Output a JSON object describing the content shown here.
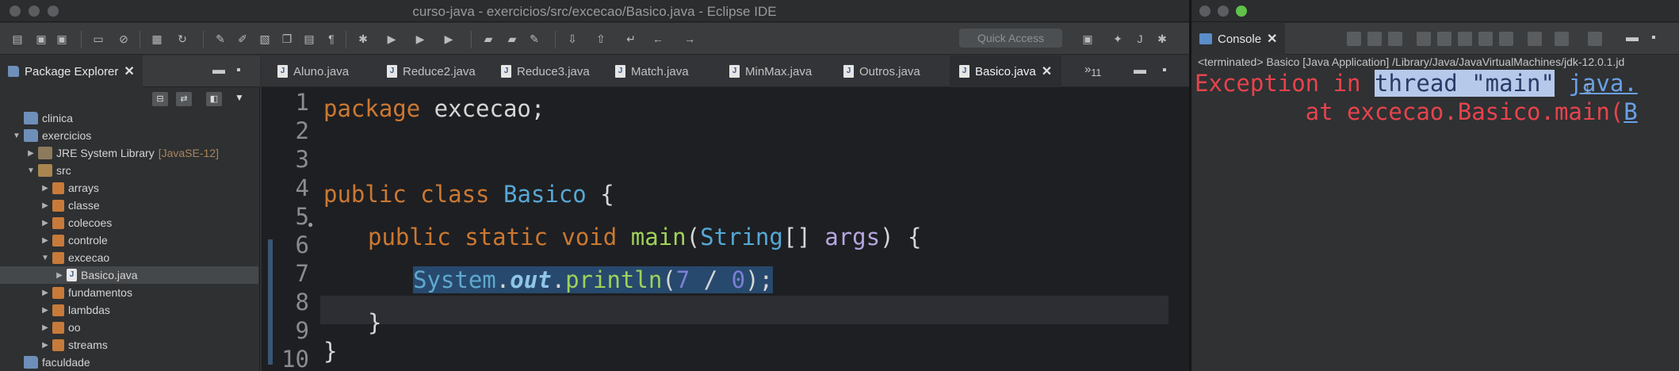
{
  "main_window": {
    "title": "curso-java - exercicios/src/excecao/Basico.java - Eclipse IDE",
    "quick_access_placeholder": "Quick Access"
  },
  "package_explorer": {
    "tab_label": "Package Explorer",
    "tree": [
      {
        "label": "clinica",
        "tag": "",
        "icon": "project-folder-icon",
        "twisty": "",
        "indent": 0
      },
      {
        "label": "exercicios",
        "tag": "",
        "icon": "project-folder-icon",
        "twisty": "▼",
        "indent": 0
      },
      {
        "label": "JRE System Library",
        "tag": "[JavaSE-12]",
        "icon": "library-icon",
        "twisty": "▶",
        "indent": 1
      },
      {
        "label": "src",
        "tag": "",
        "icon": "source-folder-icon",
        "twisty": "▼",
        "indent": 1
      },
      {
        "label": "arrays",
        "tag": "",
        "icon": "package-icon",
        "twisty": "▶",
        "indent": 2
      },
      {
        "label": "classe",
        "tag": "",
        "icon": "package-icon",
        "twisty": "▶",
        "indent": 2
      },
      {
        "label": "colecoes",
        "tag": "",
        "icon": "package-icon",
        "twisty": "▶",
        "indent": 2
      },
      {
        "label": "controle",
        "tag": "",
        "icon": "package-icon",
        "twisty": "▶",
        "indent": 2
      },
      {
        "label": "excecao",
        "tag": "",
        "icon": "package-icon",
        "twisty": "▼",
        "indent": 2
      },
      {
        "label": "Basico.java",
        "tag": "",
        "icon": "java-file-icon",
        "twisty": "▶",
        "indent": 3
      },
      {
        "label": "fundamentos",
        "tag": "",
        "icon": "package-icon",
        "twisty": "▶",
        "indent": 2
      },
      {
        "label": "lambdas",
        "tag": "",
        "icon": "package-icon",
        "twisty": "▶",
        "indent": 2
      },
      {
        "label": "oo",
        "tag": "",
        "icon": "package-icon",
        "twisty": "▶",
        "indent": 2
      },
      {
        "label": "streams",
        "tag": "",
        "icon": "package-icon",
        "twisty": "▶",
        "indent": 2
      },
      {
        "label": "faculdade",
        "tag": "",
        "icon": "project-folder-icon",
        "twisty": "",
        "indent": 0
      }
    ]
  },
  "editor": {
    "tabs": [
      {
        "label": "Aluno.java",
        "active": false
      },
      {
        "label": "Reduce2.java",
        "active": false
      },
      {
        "label": "Reduce3.java",
        "active": false
      },
      {
        "label": "Match.java",
        "active": false
      },
      {
        "label": "MinMax.java",
        "active": false
      },
      {
        "label": "Outros.java",
        "active": false
      },
      {
        "label": "Basico.java",
        "active": true
      }
    ],
    "overflow_count": "11",
    "line_numbers": [
      "1",
      "2",
      "3",
      "4",
      "5",
      "6",
      "7",
      "8",
      "9",
      "10"
    ],
    "code": {
      "l1_kw": "package",
      "l1_rest": " excecao;",
      "l3_kw": "public class",
      "l3_cls": "Basico",
      "l3_rest": " {",
      "l5_kw": "public static void",
      "l5_fn": "main",
      "l5_open": "(",
      "l5_type": "String",
      "l5_arr": "[] ",
      "l5_param": "args",
      "l5_close": ") {",
      "l7_sys": "System",
      "l7_dot1": ".",
      "l7_out": "out",
      "l7_dot2": ".",
      "l7_fn": "println",
      "l7_open": "(",
      "l7_n1": "7",
      "l7_div": " / ",
      "l7_n2": "0",
      "l7_close": ");",
      "l8": "}",
      "l9": "}"
    }
  },
  "console": {
    "tab_label": "Console",
    "status": "<terminated> Basico [Java Application] /Library/Java/JavaVirtualMachines/jdk-12.0.1.jd",
    "line1_prefix": "Exception in ",
    "line1_selected": "thread \"main\"",
    "line1_link": "java.",
    "line2_prefix": "        at excecao.Basico.main(",
    "line2_link": "B"
  }
}
